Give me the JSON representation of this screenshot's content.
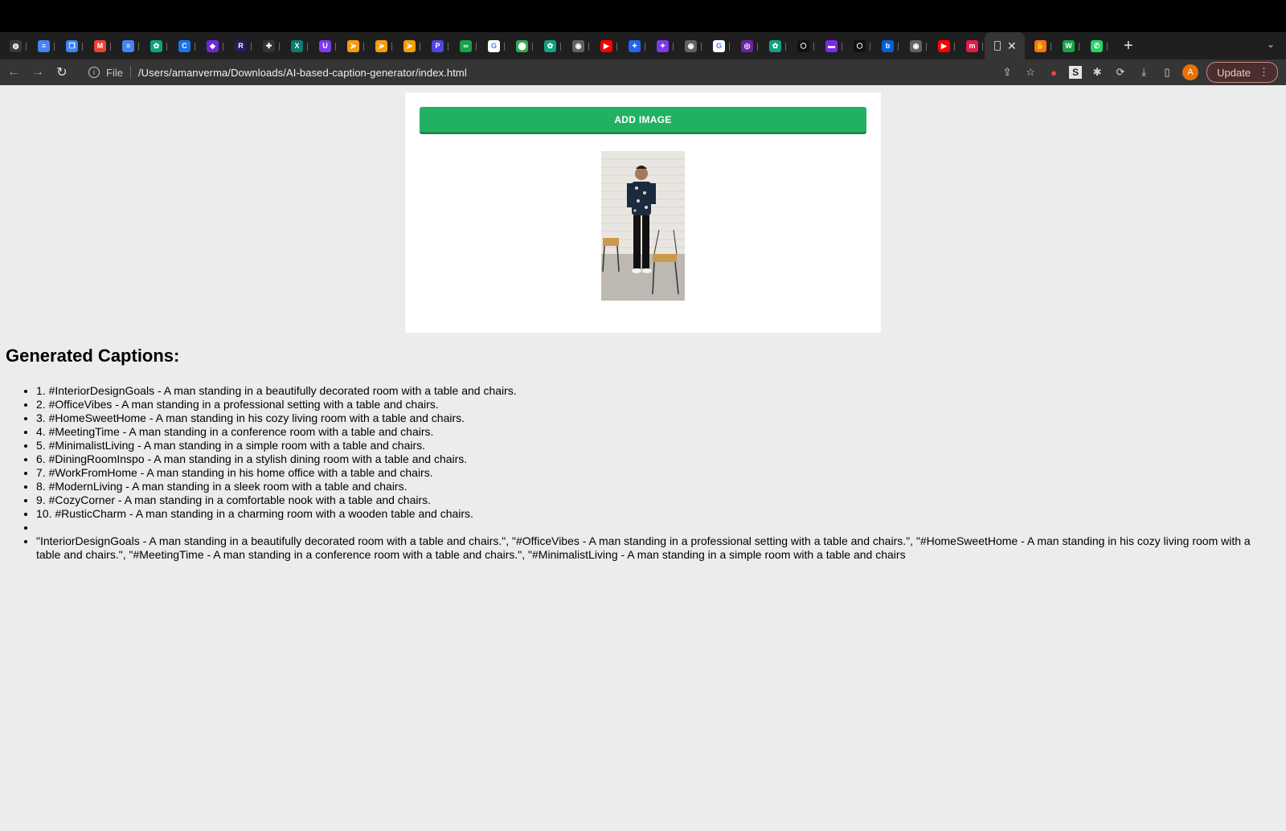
{
  "browser": {
    "address_scheme": "File",
    "url": "/Users/amanverma/Downloads/AI-based-caption-generator/index.html",
    "update_label": "Update",
    "profile_initial": "A",
    "tabs": [
      {
        "icon": "chrome-icon",
        "color": "#3a3a3a",
        "glyph": "◍"
      },
      {
        "icon": "google-docs-icon",
        "color": "#4285f4",
        "glyph": "≡"
      },
      {
        "icon": "stack-icon",
        "color": "#3b82f6",
        "glyph": "❐"
      },
      {
        "icon": "gmail-icon",
        "color": "#ea4335",
        "glyph": "M"
      },
      {
        "icon": "google-docs-icon",
        "color": "#4285f4",
        "glyph": "≡"
      },
      {
        "icon": "chatgpt-icon",
        "color": "#10a37f",
        "glyph": "✿"
      },
      {
        "icon": "circle-c-icon",
        "color": "#1a73e8",
        "glyph": "C"
      },
      {
        "icon": "shield-icon",
        "color": "#6d28d9",
        "glyph": "◆"
      },
      {
        "icon": "r-icon",
        "color": "#1e1e5a",
        "glyph": "R"
      },
      {
        "icon": "dash-icon",
        "color": "#333333",
        "glyph": "✚"
      },
      {
        "icon": "x-icon",
        "color": "#0f7a6e",
        "glyph": "X"
      },
      {
        "icon": "purple-u-icon",
        "color": "#7c3aed",
        "glyph": "U"
      },
      {
        "icon": "flag-icon",
        "color": "#f59e0b",
        "glyph": "≽"
      },
      {
        "icon": "flag-icon",
        "color": "#f59e0b",
        "glyph": "≽"
      },
      {
        "icon": "flag-icon",
        "color": "#f59e0b",
        "glyph": "≽"
      },
      {
        "icon": "p-icon",
        "color": "#4f46e5",
        "glyph": "P"
      },
      {
        "icon": "infinity-icon",
        "color": "#16a34a",
        "glyph": "∞"
      },
      {
        "icon": "google-icon",
        "color": "#ffffff",
        "glyph": "G"
      },
      {
        "icon": "maps-pin-icon",
        "color": "#34a853",
        "glyph": "⬤"
      },
      {
        "icon": "chatgpt-icon",
        "color": "#10a37f",
        "glyph": "✿"
      },
      {
        "icon": "chrome-icon",
        "color": "#5f6368",
        "glyph": "◉"
      },
      {
        "icon": "youtube-icon",
        "color": "#ff0000",
        "glyph": "▶"
      },
      {
        "icon": "sparkle-icon",
        "color": "#2563eb",
        "glyph": "✦"
      },
      {
        "icon": "sparkle-icon",
        "color": "#7c3aed",
        "glyph": "✦"
      },
      {
        "icon": "chrome-icon",
        "color": "#5f6368",
        "glyph": "◉"
      },
      {
        "icon": "google-icon",
        "color": "#ffffff",
        "glyph": "G"
      },
      {
        "icon": "circle-dot-icon",
        "color": "#6b21a8",
        "glyph": "◎"
      },
      {
        "icon": "chatgpt-icon",
        "color": "#10a37f",
        "glyph": "✿"
      },
      {
        "icon": "codepen-icon",
        "color": "#111111",
        "glyph": "⬡"
      },
      {
        "icon": "canva-icon",
        "color": "#7d2ae8",
        "glyph": "▬"
      },
      {
        "icon": "codepen-icon",
        "color": "#111111",
        "glyph": "⬡"
      },
      {
        "icon": "box-icon",
        "color": "#0061d5",
        "glyph": "b"
      },
      {
        "icon": "chrome-icon",
        "color": "#5f6368",
        "glyph": "◉"
      },
      {
        "icon": "youtube-icon",
        "color": "#ff0000",
        "glyph": "▶"
      },
      {
        "icon": "my-icon",
        "color": "#e11d48",
        "glyph": "m"
      }
    ],
    "tabs_after_active": [
      {
        "icon": "hand-icon",
        "color": "#f97316",
        "glyph": "✋"
      },
      {
        "icon": "w-icon",
        "color": "#16a34a",
        "glyph": "W"
      },
      {
        "icon": "whatsapp-icon",
        "color": "#25d366",
        "glyph": "✆"
      }
    ]
  },
  "page": {
    "add_image_label": "ADD IMAGE",
    "captions_heading": "Generated Captions:",
    "captions": [
      "1. #InteriorDesignGoals - A man standing in a beautifully decorated room with a table and chairs.",
      "2. #OfficeVibes - A man standing in a professional setting with a table and chairs.",
      "3. #HomeSweetHome - A man standing in his cozy living room with a table and chairs.",
      "4. #MeetingTime - A man standing in a conference room with a table and chairs.",
      "5. #MinimalistLiving - A man standing in a simple room with a table and chairs.",
      "6. #DiningRoomInspo - A man standing in a stylish dining room with a table and chairs.",
      "7. #WorkFromHome - A man standing in his home office with a table and chairs.",
      "8. #ModernLiving - A man standing in a sleek room with a table and chairs.",
      "9. #CozyCorner - A man standing in a comfortable nook with a table and chairs.",
      "10. #RusticCharm - A man standing in a charming room with a wooden table and chairs.",
      "",
      "\"InteriorDesignGoals - A man standing in a beautifully decorated room with a table and chairs.\", \"#OfficeVibes - A man standing in a professional setting with a table and chairs.\", \"#HomeSweetHome - A man standing in his cozy living room with a table and chairs.\", \"#MeetingTime - A man standing in a conference room with a table and chairs.\", \"#MinimalistLiving - A man standing in a simple room with a table and chairs"
    ]
  }
}
